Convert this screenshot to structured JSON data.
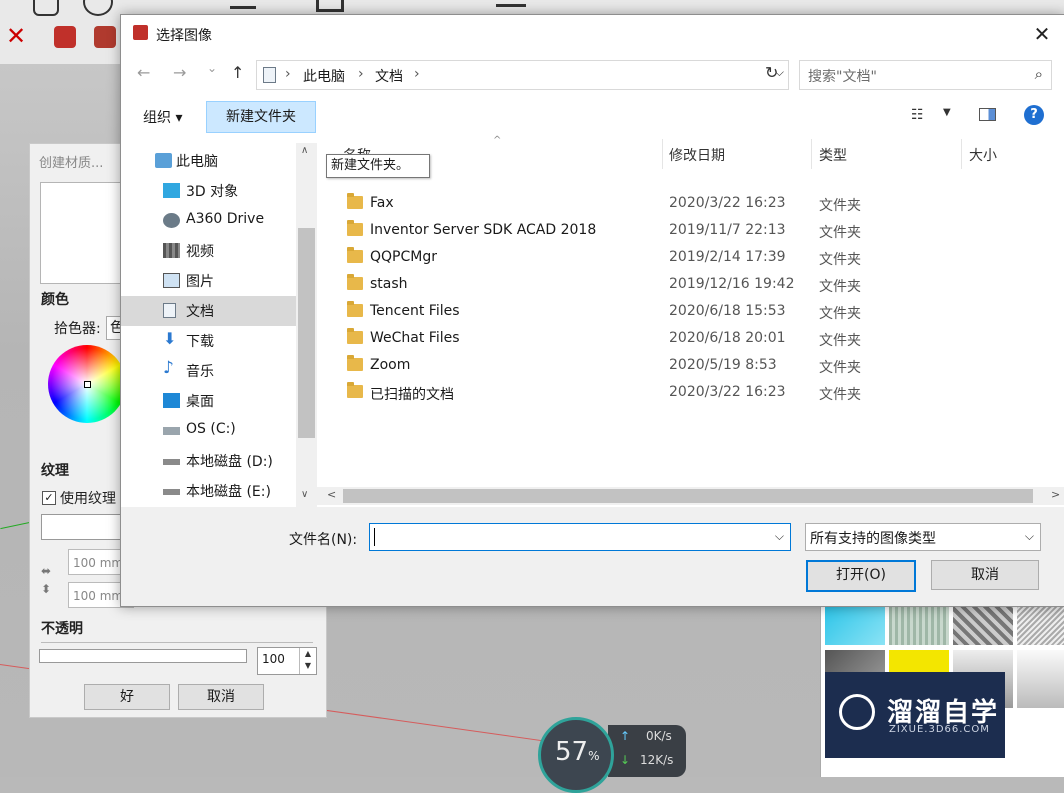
{
  "dialog": {
    "title": "选择图像",
    "close_glyph": "✕",
    "nav": {
      "back": "←",
      "forward": "→",
      "recent": "⌄",
      "up": "↑",
      "crumbs": [
        "此电脑",
        "文档"
      ],
      "crumb_sep": "›",
      "refresh": "↻",
      "search_placeholder": "搜索\"文档\""
    },
    "toolbar": {
      "organize": "组织 ▾",
      "new_folder": "新建文件夹",
      "tooltip": "新建文件夹。"
    },
    "nav_pane": [
      {
        "label": "此电脑",
        "icon": "computer-icon"
      },
      {
        "label": "3D 对象",
        "icon": "3d-objects-icon"
      },
      {
        "label": "A360 Drive",
        "icon": "a360-drive-icon"
      },
      {
        "label": "视频",
        "icon": "video-icon"
      },
      {
        "label": "图片",
        "icon": "pictures-icon"
      },
      {
        "label": "文档",
        "icon": "documents-icon",
        "selected": true
      },
      {
        "label": "下载",
        "icon": "download-icon"
      },
      {
        "label": "音乐",
        "icon": "music-icon"
      },
      {
        "label": "桌面",
        "icon": "desktop-icon"
      },
      {
        "label": "OS (C:)",
        "icon": "drive-icon"
      },
      {
        "label": "本地磁盘 (D:)",
        "icon": "drive-icon"
      },
      {
        "label": "本地磁盘 (E:)",
        "icon": "drive-icon"
      }
    ],
    "columns": {
      "name": "名称",
      "date": "修改日期",
      "type": "类型",
      "size": "大小"
    },
    "files": [
      {
        "name": "Fax",
        "date": "2020/3/22 16:23",
        "type": "文件夹"
      },
      {
        "name": "Inventor Server SDK ACAD 2018",
        "date": "2019/11/7 22:13",
        "type": "文件夹"
      },
      {
        "name": "QQPCMgr",
        "date": "2019/2/14 17:39",
        "type": "文件夹"
      },
      {
        "name": "stash",
        "date": "2019/12/16 19:42",
        "type": "文件夹"
      },
      {
        "name": "Tencent Files",
        "date": "2020/6/18 15:53",
        "type": "文件夹"
      },
      {
        "name": "WeChat Files",
        "date": "2020/6/18 20:01",
        "type": "文件夹"
      },
      {
        "name": "Zoom",
        "date": "2020/5/19 8:53",
        "type": "文件夹"
      },
      {
        "name": "已扫描的文档",
        "date": "2020/3/22 16:23",
        "type": "文件夹"
      }
    ],
    "filename_label": "文件名(N):",
    "filename_value": "",
    "filetype": "所有支持的图像类型",
    "open_button": "打开(O)",
    "cancel_button": "取消"
  },
  "material_panel": {
    "title": "创建材质...",
    "color_heading": "颜色",
    "picker_label": "拾色器:",
    "picker_value": "色",
    "texture_heading": "纹理",
    "use_texture": "使用纹理",
    "width": "100 mm",
    "height": "100 mm",
    "opacity_heading": "不透明",
    "opacity_value": "100",
    "ok": "好",
    "cancel": "取消"
  },
  "speed_widget": {
    "percent": "57",
    "pct_sign": "%",
    "up": "0K/s",
    "down": "12K/s"
  },
  "watermark": {
    "main": "溜溜自学",
    "sub": "ZIXUE.3D66.COM"
  }
}
